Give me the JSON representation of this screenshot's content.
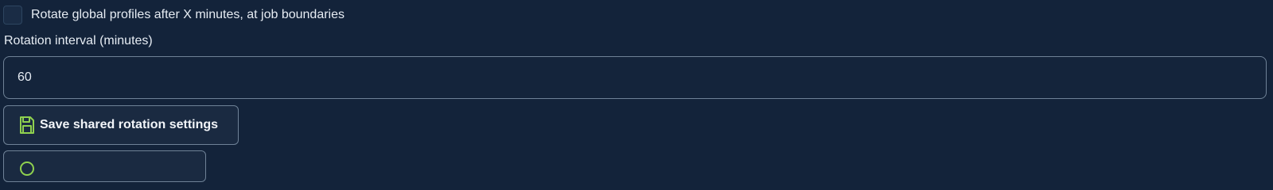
{
  "rotation": {
    "checkbox_label": "Rotate global profiles after X minutes, at job boundaries",
    "checkbox_checked": false,
    "interval_label": "Rotation interval (minutes)",
    "interval_value": "60",
    "save_button_label": "Save shared rotation settings",
    "save_icon": "floppy-disk-icon",
    "second_button_icon": "circle-icon",
    "accent_color": "#8fd14f"
  }
}
